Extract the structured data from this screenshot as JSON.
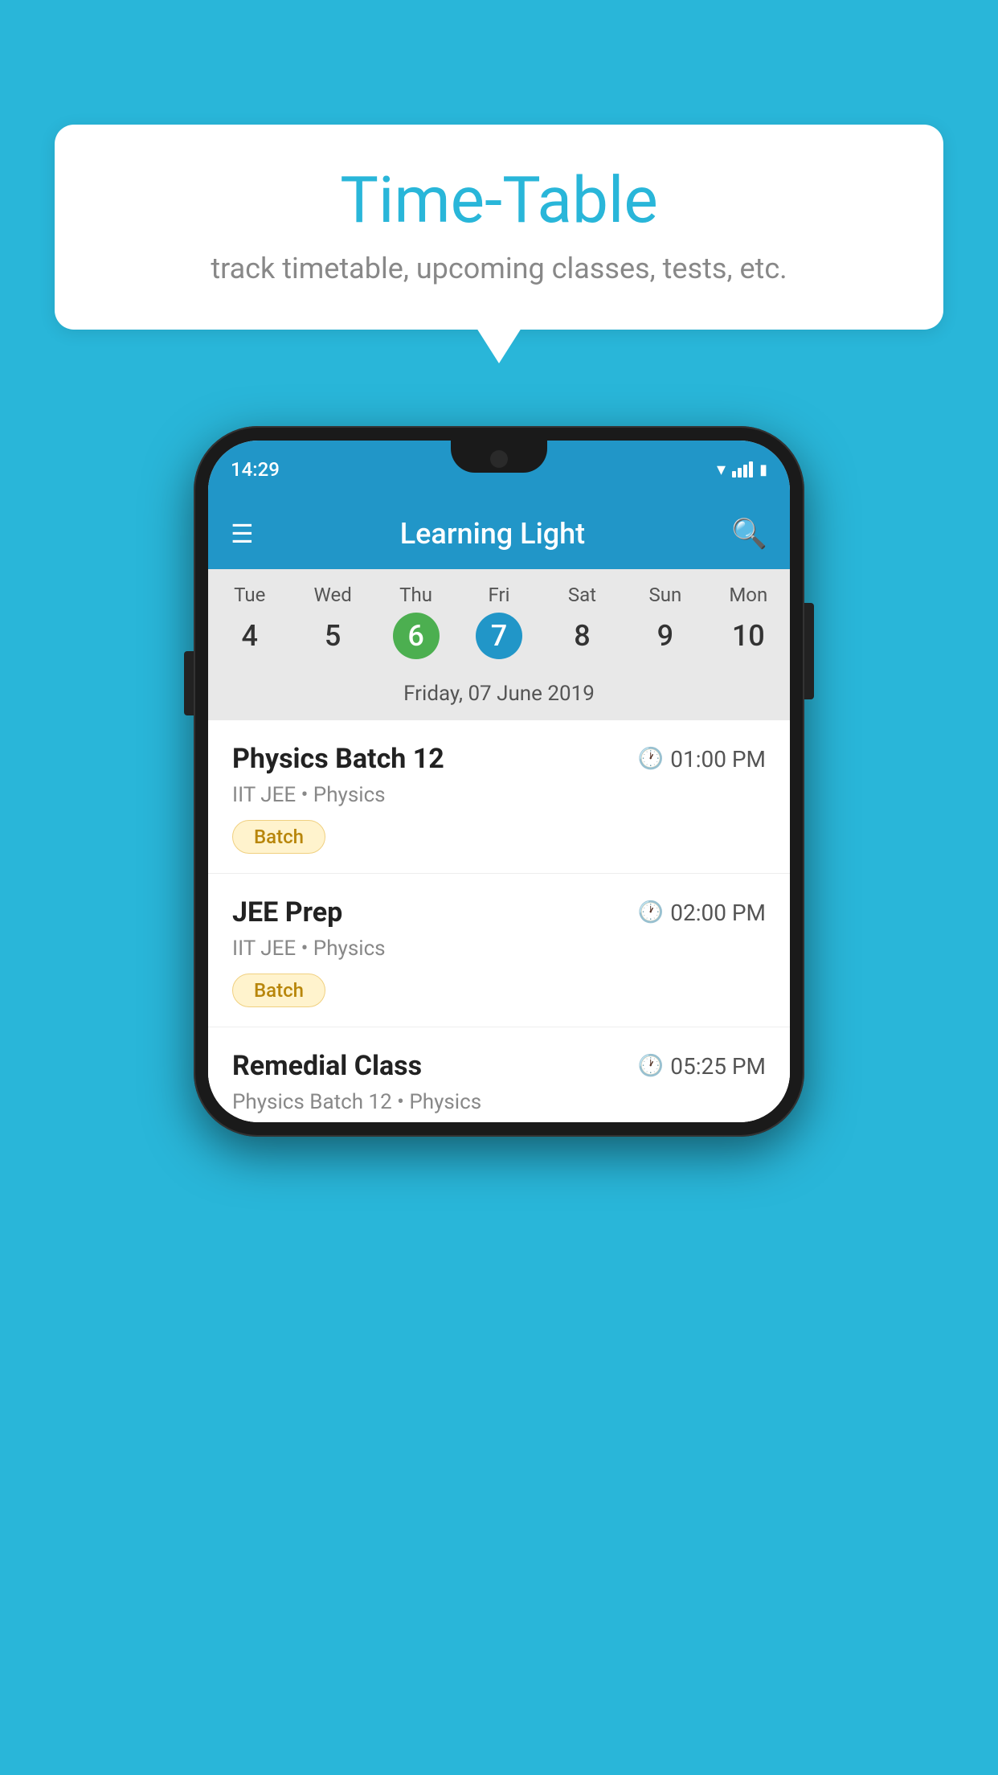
{
  "background_color": "#29B6D9",
  "bubble": {
    "title": "Time-Table",
    "subtitle": "track timetable, upcoming classes, tests, etc."
  },
  "phone": {
    "status_bar": {
      "time": "14:29"
    },
    "app_bar": {
      "title": "Learning Light"
    },
    "calendar": {
      "days": [
        {
          "name": "Tue",
          "num": "4",
          "state": "normal"
        },
        {
          "name": "Wed",
          "num": "5",
          "state": "normal"
        },
        {
          "name": "Thu",
          "num": "6",
          "state": "today"
        },
        {
          "name": "Fri",
          "num": "7",
          "state": "selected"
        },
        {
          "name": "Sat",
          "num": "8",
          "state": "normal"
        },
        {
          "name": "Sun",
          "num": "9",
          "state": "normal"
        },
        {
          "name": "Mon",
          "num": "10",
          "state": "normal"
        }
      ],
      "selected_date": "Friday, 07 June 2019"
    },
    "classes": [
      {
        "name": "Physics Batch 12",
        "time": "01:00 PM",
        "meta": "IIT JEE • Physics",
        "badge": "Batch"
      },
      {
        "name": "JEE Prep",
        "time": "02:00 PM",
        "meta": "IIT JEE • Physics",
        "badge": "Batch"
      },
      {
        "name": "Remedial Class",
        "time": "05:25 PM",
        "meta": "Physics Batch 12 • Physics",
        "badge": null
      }
    ]
  }
}
